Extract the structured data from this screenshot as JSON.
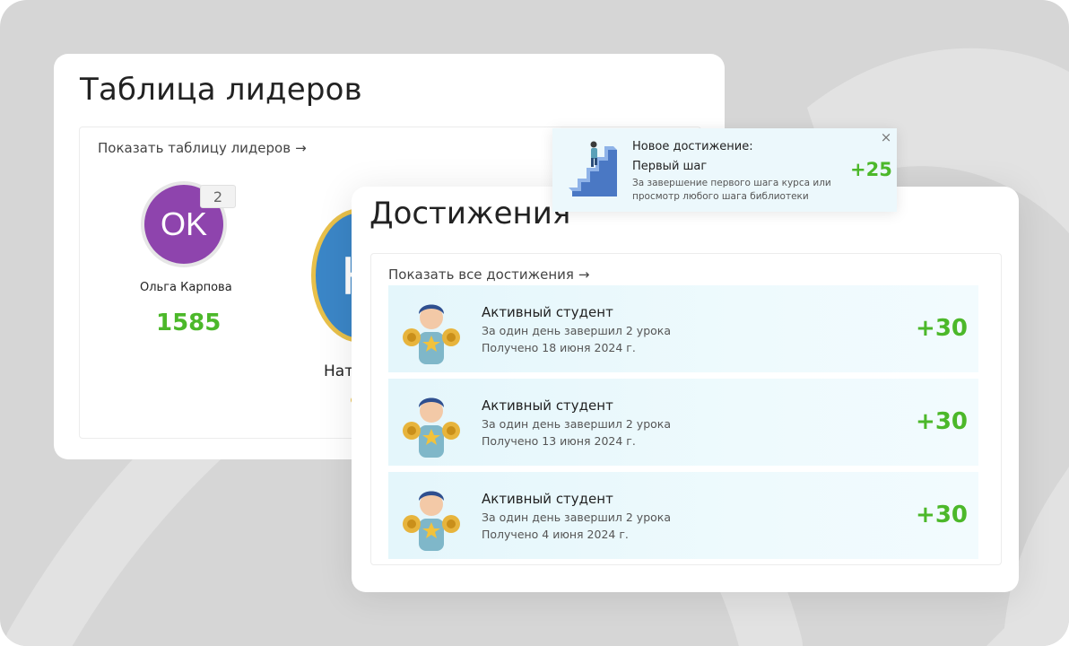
{
  "leaderboard": {
    "title": "Таблица лидеров",
    "show_link": "Показать таблицу лидеров",
    "players": [
      {
        "initials": "OK",
        "rank": "2",
        "name": "Ольга Карпова",
        "score": "1585",
        "avatar_color": "#8e44ad"
      },
      {
        "initials": "Н",
        "name": "Нат",
        "avatar_color": "#3b86c7"
      }
    ]
  },
  "achievements": {
    "title": "Достижения",
    "show_link": "Показать все достижения",
    "items": [
      {
        "title": "Активный студент",
        "description": "За один день завершил 2 урока",
        "date": "Получено 18 июня 2024 г.",
        "points": "+30"
      },
      {
        "title": "Активный студент",
        "description": "За один день завершил 2 урока",
        "date": "Получено 13 июня 2024 г.",
        "points": "+30"
      },
      {
        "title": "Активный студент",
        "description": "За один день завершил 2 урока",
        "date": "Получено 4 июня 2024 г.",
        "points": "+30"
      }
    ]
  },
  "toast": {
    "heading": "Новое достижение:",
    "title": "Первый шаг",
    "description": "За завершение первого шага курса или просмотр любого шага библиотеки",
    "points": "+25",
    "close": "×"
  },
  "icons": {
    "arrow": "→",
    "achievement_figure": "student-with-medals-icon",
    "toast_figure": "stairs-climber-icon"
  },
  "colors": {
    "background": "#d6d6d6",
    "points_green": "#4cb82a",
    "achievement_bg": "#e4f6fb"
  }
}
